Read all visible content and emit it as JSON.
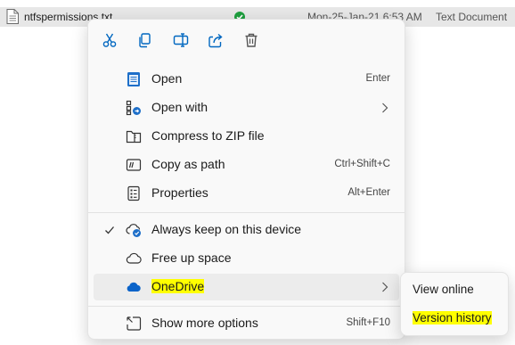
{
  "file": {
    "name": "ntfspermissions.txt",
    "date": "Mon-25-Jan-21 6:53 AM",
    "type": "Text Document"
  },
  "toolbar": {
    "cut": "scissors-icon",
    "copy": "copy-icon",
    "rename": "rename-icon",
    "share": "share-icon",
    "delete": "trash-icon"
  },
  "menu": {
    "open": {
      "label": "Open",
      "shortcut": "Enter"
    },
    "open_with": {
      "label": "Open with"
    },
    "compress": {
      "label": "Compress to ZIP file"
    },
    "copy_path": {
      "label": "Copy as path",
      "shortcut": "Ctrl+Shift+C"
    },
    "properties": {
      "label": "Properties",
      "shortcut": "Alt+Enter"
    },
    "always_keep": {
      "label": "Always keep on this device"
    },
    "free_up": {
      "label": "Free up space"
    },
    "onedrive": {
      "label": "OneDrive"
    },
    "show_more": {
      "label": "Show more options",
      "shortcut": "Shift+F10"
    }
  },
  "submenu": {
    "view_online": "View online",
    "version_history": "Version history"
  },
  "colors": {
    "accent": "#0067c0",
    "highlight": "#ffff00",
    "sync_green": "#1e9e3e"
  }
}
